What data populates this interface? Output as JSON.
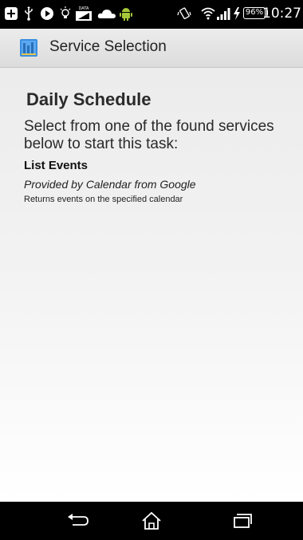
{
  "status_bar": {
    "time": "10:27",
    "battery_percent": "96%",
    "data_label": "DATA",
    "icons": [
      "add-icon",
      "usb-icon",
      "play-icon",
      "lightbulb-icon",
      "data-icon",
      "cloud-icon",
      "android-icon",
      "vibrate-icon",
      "wifi-icon",
      "signal-icon",
      "charging-icon",
      "battery-icon"
    ]
  },
  "action_bar": {
    "title": "Service Selection",
    "icon": "app-icon"
  },
  "main": {
    "title": "Daily Schedule",
    "instructions": "Select from one of the found services below to start this task:",
    "services": [
      {
        "name": "List Events",
        "provider": "Provided by Calendar from Google",
        "description": "Returns events on the specified calendar"
      }
    ]
  },
  "nav_bar": {
    "buttons": [
      "back-icon",
      "home-icon",
      "recent-apps-icon"
    ]
  },
  "colors": {
    "status_bar_bg": "#000000",
    "action_bar_bg": "#e4e4e4",
    "app_icon_blue": "#3a8ee0",
    "text_primary": "#2a2a2a"
  }
}
